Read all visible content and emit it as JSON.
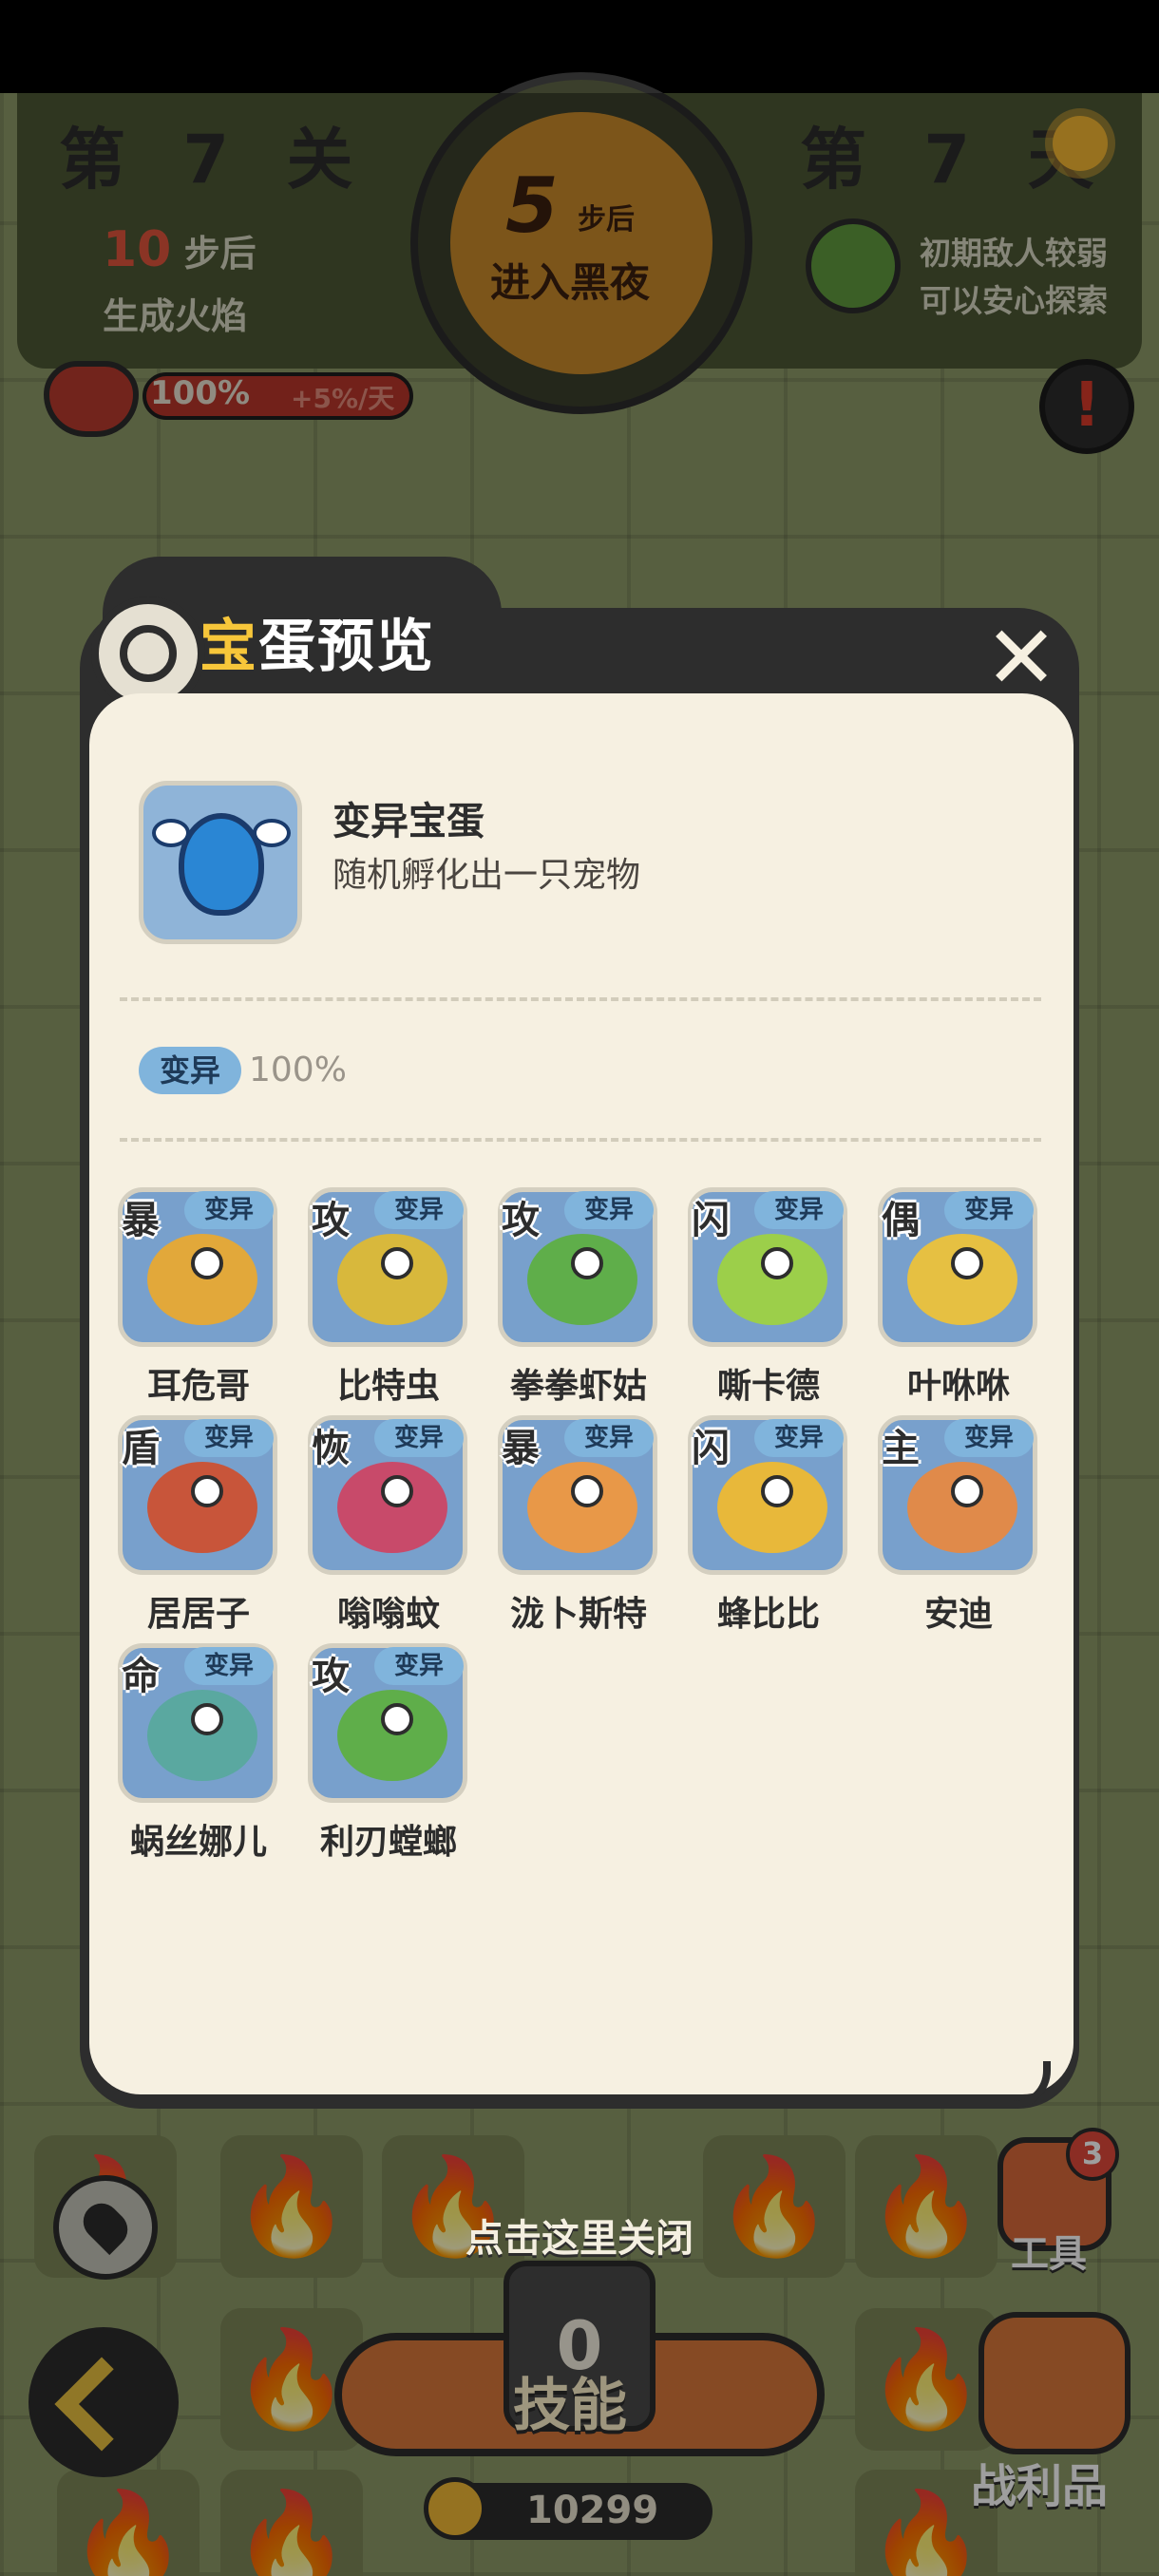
{
  "hud": {
    "level_label": "第 7 关",
    "day_label": "第 7 天",
    "fire_steps_num": "10",
    "fire_steps_suffix": "步后",
    "fire_steps_line2": "生成火焰",
    "night_steps_num": "5",
    "night_steps_unit": "步后",
    "night_steps_text": "进入黑夜",
    "enemy_hint_1": "初期敌人较弱",
    "enemy_hint_2": "可以安心探索",
    "hp_value": "100%",
    "hp_fraction": 1.0,
    "hp_regen": "+5%/天",
    "alert_label": "!",
    "icons": {
      "sun": "sun-icon",
      "enemy": "demon-face-icon",
      "heart": "heart-icon",
      "alert": "exclamation-icon",
      "location": "location-pin-icon",
      "back": "back-arrow-icon",
      "coin": "coin-icon",
      "fire": "fire-icon"
    }
  },
  "board_bottom": {
    "close_hint": "点击这里关闭",
    "skill_count": "0",
    "skill_label": "技能",
    "coin_value": "10299",
    "tools_badge": "3",
    "tools_label": "工具",
    "loot_label": "战利品"
  },
  "dialog": {
    "title_first": "宝",
    "title_rest": "蛋预览",
    "close_label": "✕",
    "egg": {
      "name": "变异宝蛋",
      "description": "随机孵化出一只宠物"
    },
    "type_tag": "变异",
    "type_rate": "100%",
    "pets": [
      {
        "role": "暴",
        "tag": "变异",
        "name": "耳危哥",
        "color": "#e2a83a"
      },
      {
        "role": "攻",
        "tag": "变异",
        "name": "比特虫",
        "color": "#d8b83c"
      },
      {
        "role": "攻",
        "tag": "变异",
        "name": "拳拳虾姑",
        "color": "#5fae4a"
      },
      {
        "role": "闪",
        "tag": "变异",
        "name": "嘶卡德",
        "color": "#9ccf4a"
      },
      {
        "role": "偶",
        "tag": "变异",
        "name": "叶咻咻",
        "color": "#e6c042"
      },
      {
        "role": "盾",
        "tag": "变异",
        "name": "居居子",
        "color": "#c8553a"
      },
      {
        "role": "恢",
        "tag": "变异",
        "name": "嗡嗡蚊",
        "color": "#c84a6a"
      },
      {
        "role": "暴",
        "tag": "变异",
        "name": "泷卜斯特",
        "color": "#e89848"
      },
      {
        "role": "闪",
        "tag": "变异",
        "name": "蜂比比",
        "color": "#e8b83a"
      },
      {
        "role": "主",
        "tag": "变异",
        "name": "安迪",
        "color": "#e08a4a"
      },
      {
        "role": "命",
        "tag": "变异",
        "name": "蜗丝娜儿",
        "color": "#5aa8a0"
      },
      {
        "role": "攻",
        "tag": "变异",
        "name": "利刃螳螂",
        "color": "#5fae4a"
      }
    ]
  }
}
